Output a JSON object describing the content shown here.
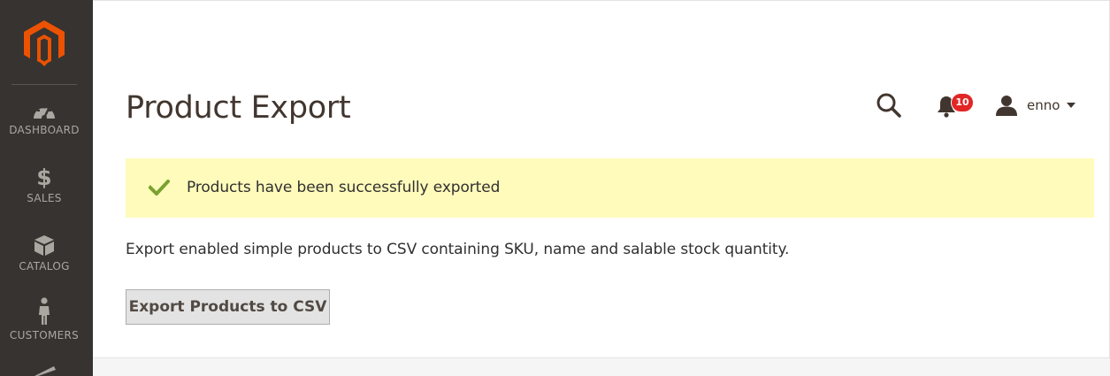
{
  "sidebar": {
    "logo_icon": "magento-logo-icon",
    "items": [
      {
        "label": "DASHBOARD",
        "icon": "dashboard-gauge-icon"
      },
      {
        "label": "SALES",
        "icon": "dollar-icon"
      },
      {
        "label": "CATALOG",
        "icon": "box-icon"
      },
      {
        "label": "CUSTOMERS",
        "icon": "person-icon"
      }
    ]
  },
  "header": {
    "title": "Product Export",
    "search_icon": "search-icon",
    "notifications": {
      "icon": "bell-icon",
      "count": "10"
    },
    "user": {
      "icon": "user-icon",
      "name": "enno"
    }
  },
  "message": {
    "type": "success",
    "icon": "checkmark-icon",
    "text": "Products have been successfully exported"
  },
  "description": "Export enabled simple products to CSV containing SKU, name and salable stock quantity.",
  "export_button": {
    "label": "Export Products to CSV"
  },
  "colors": {
    "sidebar_bg": "#373330",
    "logo_orange": "#eb5202",
    "success_bg": "#fffbbb",
    "success_check": "#79a22e",
    "badge_red": "#e22626",
    "button_bg": "#e3e3e3"
  }
}
